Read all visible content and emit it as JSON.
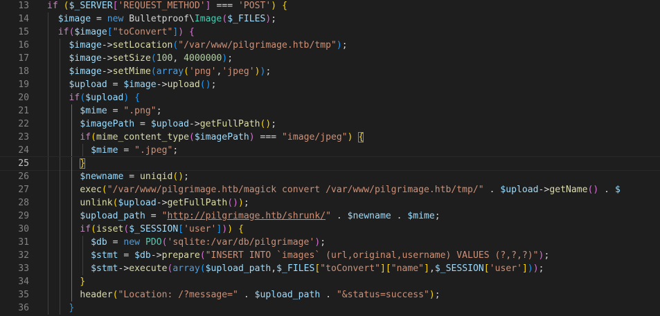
{
  "editor": {
    "active_line": 25,
    "lines": [
      {
        "no": "13",
        "tokens": [
          {
            "t": "if",
            "c": "c"
          },
          {
            "t": " ",
            "c": "p"
          },
          {
            "t": "(",
            "c": "b1"
          },
          {
            "t": "$_SERVER",
            "c": "v"
          },
          {
            "t": "[",
            "c": "b2"
          },
          {
            "t": "'REQUEST_METHOD'",
            "c": "s"
          },
          {
            "t": "]",
            "c": "b2"
          },
          {
            "t": " === ",
            "c": "p"
          },
          {
            "t": "'POST'",
            "c": "s"
          },
          {
            "t": ")",
            "c": "b1"
          },
          {
            "t": " ",
            "c": "p"
          },
          {
            "t": "{",
            "c": "b1"
          }
        ],
        "guides": []
      },
      {
        "no": "14",
        "tokens": [
          {
            "t": "  ",
            "c": "p"
          },
          {
            "t": "$image",
            "c": "v"
          },
          {
            "t": " = ",
            "c": "p"
          },
          {
            "t": "new",
            "c": "k"
          },
          {
            "t": " Bulletproof\\",
            "c": "p"
          },
          {
            "t": "Image",
            "c": "t"
          },
          {
            "t": "(",
            "c": "b2"
          },
          {
            "t": "$_FILES",
            "c": "v"
          },
          {
            "t": ")",
            "c": "b2"
          },
          {
            "t": ";",
            "c": "p"
          }
        ],
        "guides": [
          1
        ]
      },
      {
        "no": "15",
        "tokens": [
          {
            "t": "  ",
            "c": "p"
          },
          {
            "t": "if",
            "c": "c"
          },
          {
            "t": "(",
            "c": "b2"
          },
          {
            "t": "$image",
            "c": "v"
          },
          {
            "t": "[",
            "c": "b3"
          },
          {
            "t": "\"toConvert\"",
            "c": "s"
          },
          {
            "t": "]",
            "c": "b3"
          },
          {
            "t": ")",
            "c": "b2"
          },
          {
            "t": " ",
            "c": "p"
          },
          {
            "t": "{",
            "c": "b2"
          }
        ],
        "guides": [
          1
        ]
      },
      {
        "no": "16",
        "tokens": [
          {
            "t": "    ",
            "c": "p"
          },
          {
            "t": "$image",
            "c": "v"
          },
          {
            "t": "->",
            "c": "p"
          },
          {
            "t": "setLocation",
            "c": "f"
          },
          {
            "t": "(",
            "c": "b3"
          },
          {
            "t": "\"/var/www/pilgrimage.htb/tmp\"",
            "c": "s"
          },
          {
            "t": ")",
            "c": "b3"
          },
          {
            "t": ";",
            "c": "p"
          }
        ],
        "guides": [
          1,
          2
        ]
      },
      {
        "no": "17",
        "tokens": [
          {
            "t": "    ",
            "c": "p"
          },
          {
            "t": "$image",
            "c": "v"
          },
          {
            "t": "->",
            "c": "p"
          },
          {
            "t": "setSize",
            "c": "f"
          },
          {
            "t": "(",
            "c": "b3"
          },
          {
            "t": "100",
            "c": "n"
          },
          {
            "t": ", ",
            "c": "p"
          },
          {
            "t": "4000000",
            "c": "n"
          },
          {
            "t": ")",
            "c": "b3"
          },
          {
            "t": ";",
            "c": "p"
          }
        ],
        "guides": [
          1,
          2
        ]
      },
      {
        "no": "18",
        "tokens": [
          {
            "t": "    ",
            "c": "p"
          },
          {
            "t": "$image",
            "c": "v"
          },
          {
            "t": "->",
            "c": "p"
          },
          {
            "t": "setMime",
            "c": "f"
          },
          {
            "t": "(",
            "c": "b3"
          },
          {
            "t": "array",
            "c": "k"
          },
          {
            "t": "(",
            "c": "b1"
          },
          {
            "t": "'png'",
            "c": "s"
          },
          {
            "t": ",",
            "c": "p"
          },
          {
            "t": "'jpeg'",
            "c": "s"
          },
          {
            "t": ")",
            "c": "b1"
          },
          {
            "t": ")",
            "c": "b3"
          },
          {
            "t": ";",
            "c": "p"
          }
        ],
        "guides": [
          1,
          2
        ]
      },
      {
        "no": "19",
        "tokens": [
          {
            "t": "    ",
            "c": "p"
          },
          {
            "t": "$upload",
            "c": "v"
          },
          {
            "t": " = ",
            "c": "p"
          },
          {
            "t": "$image",
            "c": "v"
          },
          {
            "t": "->",
            "c": "p"
          },
          {
            "t": "upload",
            "c": "f"
          },
          {
            "t": "(",
            "c": "b3"
          },
          {
            "t": ")",
            "c": "b3"
          },
          {
            "t": ";",
            "c": "p"
          }
        ],
        "guides": [
          1,
          2
        ]
      },
      {
        "no": "20",
        "tokens": [
          {
            "t": "    ",
            "c": "p"
          },
          {
            "t": "if",
            "c": "c"
          },
          {
            "t": "(",
            "c": "b3"
          },
          {
            "t": "$upload",
            "c": "v"
          },
          {
            "t": ")",
            "c": "b3"
          },
          {
            "t": " ",
            "c": "p"
          },
          {
            "t": "{",
            "c": "b3"
          }
        ],
        "guides": [
          1,
          2
        ]
      },
      {
        "no": "21",
        "tokens": [
          {
            "t": "      ",
            "c": "p"
          },
          {
            "t": "$mime",
            "c": "v"
          },
          {
            "t": " = ",
            "c": "p"
          },
          {
            "t": "\".png\"",
            "c": "s"
          },
          {
            "t": ";",
            "c": "p"
          }
        ],
        "guides": [
          1,
          2,
          3
        ]
      },
      {
        "no": "22",
        "tokens": [
          {
            "t": "      ",
            "c": "p"
          },
          {
            "t": "$imagePath",
            "c": "v"
          },
          {
            "t": " = ",
            "c": "p"
          },
          {
            "t": "$upload",
            "c": "v"
          },
          {
            "t": "->",
            "c": "p"
          },
          {
            "t": "getFullPath",
            "c": "f"
          },
          {
            "t": "(",
            "c": "b1"
          },
          {
            "t": ")",
            "c": "b1"
          },
          {
            "t": ";",
            "c": "p"
          }
        ],
        "guides": [
          1,
          2,
          3
        ]
      },
      {
        "no": "23",
        "tokens": [
          {
            "t": "      ",
            "c": "p"
          },
          {
            "t": "if",
            "c": "c"
          },
          {
            "t": "(",
            "c": "b1"
          },
          {
            "t": "mime_content_type",
            "c": "f"
          },
          {
            "t": "(",
            "c": "b2"
          },
          {
            "t": "$imagePath",
            "c": "v"
          },
          {
            "t": ")",
            "c": "b2"
          },
          {
            "t": " === ",
            "c": "p"
          },
          {
            "t": "\"image/jpeg\"",
            "c": "s"
          },
          {
            "t": ")",
            "c": "b1"
          },
          {
            "t": " ",
            "c": "p"
          },
          {
            "t": "{",
            "c": "b1",
            "m": true
          }
        ],
        "guides": [
          1,
          2,
          3
        ]
      },
      {
        "no": "24",
        "tokens": [
          {
            "t": "        ",
            "c": "p"
          },
          {
            "t": "$mime",
            "c": "v"
          },
          {
            "t": " = ",
            "c": "p"
          },
          {
            "t": "\".jpeg\"",
            "c": "s"
          },
          {
            "t": ";",
            "c": "p"
          }
        ],
        "guides": [
          1,
          2,
          3,
          4
        ]
      },
      {
        "no": "25",
        "tokens": [
          {
            "t": "      ",
            "c": "p"
          },
          {
            "t": "}",
            "c": "b1",
            "m": true
          }
        ],
        "guides": [
          1,
          2,
          3
        ]
      },
      {
        "no": "26",
        "tokens": [
          {
            "t": "      ",
            "c": "p"
          },
          {
            "t": "$newname",
            "c": "v"
          },
          {
            "t": " = ",
            "c": "p"
          },
          {
            "t": "uniqid",
            "c": "f"
          },
          {
            "t": "(",
            "c": "b1"
          },
          {
            "t": ")",
            "c": "b1"
          },
          {
            "t": ";",
            "c": "p"
          }
        ],
        "guides": [
          1,
          2,
          3
        ]
      },
      {
        "no": "27",
        "tokens": [
          {
            "t": "      ",
            "c": "p"
          },
          {
            "t": "exec",
            "c": "f"
          },
          {
            "t": "(",
            "c": "b1"
          },
          {
            "t": "\"/var/www/pilgrimage.htb/magick convert /var/www/pilgrimage.htb/tmp/\"",
            "c": "s"
          },
          {
            "t": " . ",
            "c": "p"
          },
          {
            "t": "$upload",
            "c": "v"
          },
          {
            "t": "->",
            "c": "p"
          },
          {
            "t": "getName",
            "c": "f"
          },
          {
            "t": "(",
            "c": "b2"
          },
          {
            "t": ")",
            "c": "b2"
          },
          {
            "t": " . ",
            "c": "p"
          },
          {
            "t": "$",
            "c": "v"
          }
        ],
        "guides": [
          1,
          2,
          3
        ]
      },
      {
        "no": "28",
        "tokens": [
          {
            "t": "      ",
            "c": "p"
          },
          {
            "t": "unlink",
            "c": "f"
          },
          {
            "t": "(",
            "c": "b1"
          },
          {
            "t": "$upload",
            "c": "v"
          },
          {
            "t": "->",
            "c": "p"
          },
          {
            "t": "getFullPath",
            "c": "f"
          },
          {
            "t": "(",
            "c": "b2"
          },
          {
            "t": ")",
            "c": "b2"
          },
          {
            "t": ")",
            "c": "b1"
          },
          {
            "t": ";",
            "c": "p"
          }
        ],
        "guides": [
          1,
          2,
          3
        ]
      },
      {
        "no": "29",
        "tokens": [
          {
            "t": "      ",
            "c": "p"
          },
          {
            "t": "$upload_path",
            "c": "v"
          },
          {
            "t": " = ",
            "c": "p"
          },
          {
            "t": "\"",
            "c": "s"
          },
          {
            "t": "http://pilgrimage.htb/shrunk/",
            "c": "s u"
          },
          {
            "t": "\"",
            "c": "s"
          },
          {
            "t": " . ",
            "c": "p"
          },
          {
            "t": "$newname",
            "c": "v"
          },
          {
            "t": " . ",
            "c": "p"
          },
          {
            "t": "$mime",
            "c": "v"
          },
          {
            "t": ";",
            "c": "p"
          }
        ],
        "guides": [
          1,
          2,
          3
        ]
      },
      {
        "no": "30",
        "tokens": [
          {
            "t": "      ",
            "c": "p"
          },
          {
            "t": "if",
            "c": "c"
          },
          {
            "t": "(",
            "c": "b1"
          },
          {
            "t": "isset",
            "c": "f"
          },
          {
            "t": "(",
            "c": "b2"
          },
          {
            "t": "$_SESSION",
            "c": "v"
          },
          {
            "t": "[",
            "c": "b3"
          },
          {
            "t": "'user'",
            "c": "s"
          },
          {
            "t": "]",
            "c": "b3"
          },
          {
            "t": ")",
            "c": "b2"
          },
          {
            "t": ")",
            "c": "b1"
          },
          {
            "t": " ",
            "c": "p"
          },
          {
            "t": "{",
            "c": "b1"
          }
        ],
        "guides": [
          1,
          2,
          3
        ]
      },
      {
        "no": "31",
        "tokens": [
          {
            "t": "        ",
            "c": "p"
          },
          {
            "t": "$db",
            "c": "v"
          },
          {
            "t": " = ",
            "c": "p"
          },
          {
            "t": "new",
            "c": "k"
          },
          {
            "t": " ",
            "c": "p"
          },
          {
            "t": "PDO",
            "c": "t"
          },
          {
            "t": "(",
            "c": "b2"
          },
          {
            "t": "'sqlite:/var/db/pilgrimage'",
            "c": "s"
          },
          {
            "t": ")",
            "c": "b2"
          },
          {
            "t": ";",
            "c": "p"
          }
        ],
        "guides": [
          1,
          2,
          3,
          4
        ]
      },
      {
        "no": "32",
        "tokens": [
          {
            "t": "        ",
            "c": "p"
          },
          {
            "t": "$stmt",
            "c": "v"
          },
          {
            "t": " = ",
            "c": "p"
          },
          {
            "t": "$db",
            "c": "v"
          },
          {
            "t": "->",
            "c": "p"
          },
          {
            "t": "prepare",
            "c": "f"
          },
          {
            "t": "(",
            "c": "b2"
          },
          {
            "t": "\"INSERT INTO `images` (url,original,username) VALUES (?,?,?)\"",
            "c": "s"
          },
          {
            "t": ")",
            "c": "b2"
          },
          {
            "t": ";",
            "c": "p"
          }
        ],
        "guides": [
          1,
          2,
          3,
          4
        ]
      },
      {
        "no": "33",
        "tokens": [
          {
            "t": "        ",
            "c": "p"
          },
          {
            "t": "$stmt",
            "c": "v"
          },
          {
            "t": "->",
            "c": "p"
          },
          {
            "t": "execute",
            "c": "f"
          },
          {
            "t": "(",
            "c": "b2"
          },
          {
            "t": "array",
            "c": "k"
          },
          {
            "t": "(",
            "c": "b3"
          },
          {
            "t": "$upload_path",
            "c": "v"
          },
          {
            "t": ",",
            "c": "p"
          },
          {
            "t": "$_FILES",
            "c": "v"
          },
          {
            "t": "[",
            "c": "b1"
          },
          {
            "t": "\"toConvert\"",
            "c": "s"
          },
          {
            "t": "]",
            "c": "b1"
          },
          {
            "t": "[",
            "c": "b1"
          },
          {
            "t": "\"name\"",
            "c": "s"
          },
          {
            "t": "]",
            "c": "b1"
          },
          {
            "t": ",",
            "c": "p"
          },
          {
            "t": "$_SESSION",
            "c": "v"
          },
          {
            "t": "[",
            "c": "b1"
          },
          {
            "t": "'user'",
            "c": "s"
          },
          {
            "t": "]",
            "c": "b1"
          },
          {
            "t": ")",
            "c": "b3"
          },
          {
            "t": ")",
            "c": "b2"
          },
          {
            "t": ";",
            "c": "p"
          }
        ],
        "guides": [
          1,
          2,
          3,
          4
        ]
      },
      {
        "no": "34",
        "tokens": [
          {
            "t": "      ",
            "c": "p"
          },
          {
            "t": "}",
            "c": "b1"
          }
        ],
        "guides": [
          1,
          2,
          3
        ]
      },
      {
        "no": "35",
        "tokens": [
          {
            "t": "      ",
            "c": "p"
          },
          {
            "t": "header",
            "c": "f"
          },
          {
            "t": "(",
            "c": "b1"
          },
          {
            "t": "\"Location: /?message=\"",
            "c": "s"
          },
          {
            "t": " . ",
            "c": "p"
          },
          {
            "t": "$upload_path",
            "c": "v"
          },
          {
            "t": " . ",
            "c": "p"
          },
          {
            "t": "\"&status=success\"",
            "c": "s"
          },
          {
            "t": ")",
            "c": "b1"
          },
          {
            "t": ";",
            "c": "p"
          }
        ],
        "guides": [
          1,
          2,
          3
        ]
      },
      {
        "no": "36",
        "tokens": [
          {
            "t": "    ",
            "c": "p"
          },
          {
            "t": "}",
            "c": "b3"
          }
        ],
        "guides": [
          1,
          2
        ]
      }
    ]
  }
}
